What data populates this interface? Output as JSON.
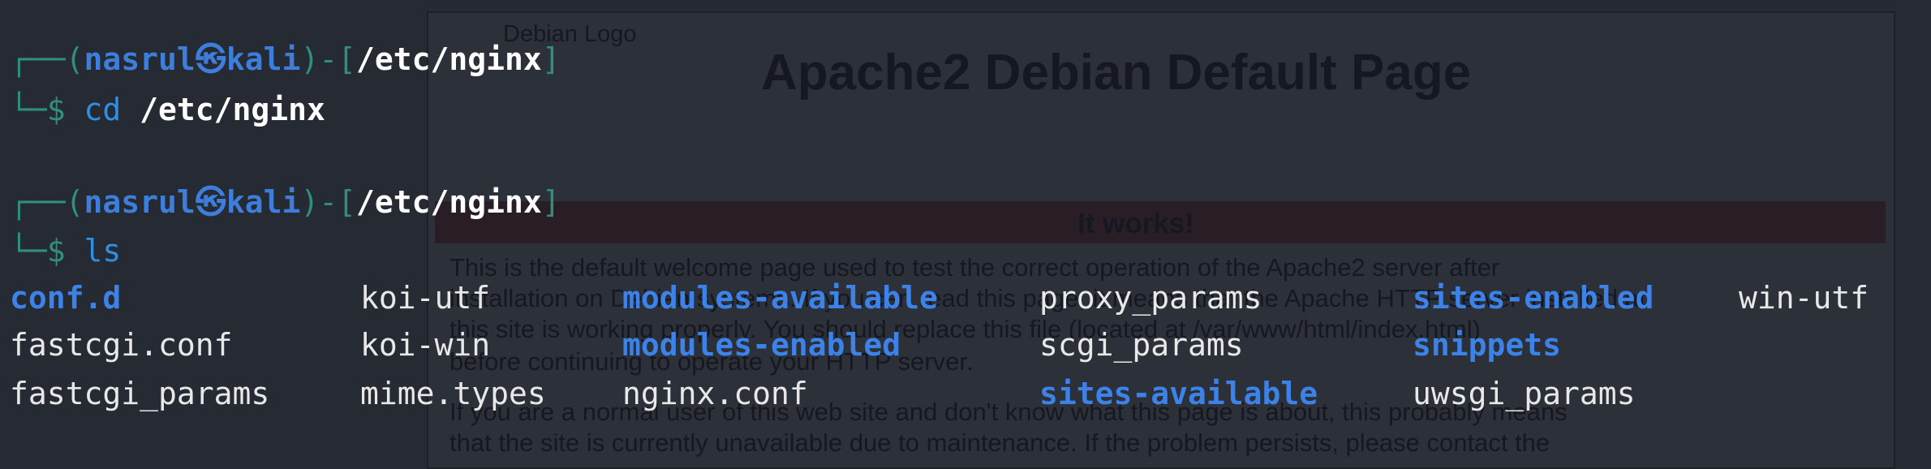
{
  "background_page": {
    "logo_alt": "Debian Logo",
    "title": "Apache2 Debian Default Page",
    "banner": "It works!",
    "paragraph_lines": [
      "This is the default welcome page used to test the correct operation of the Apache2 server after",
      "installation on Debian systems. If you can read this page, it means that the Apache HTTP server installed at",
      "this site is working properly. You should replace this file (located at /var/www/html/index.html)",
      "before continuing to operate your HTTP server.",
      "If you are a normal user of this web site and don't know what this page is about, this probably means",
      "that the site is currently unavailable due to maintenance. If the problem persists, please contact the"
    ]
  },
  "terminal": {
    "prompts": [
      {
        "frame_open": "┌──(",
        "user": "nasrul",
        "symbol": "㉿",
        "host": "kali",
        "frame_mid": ")-[",
        "path": "/etc/nginx",
        "frame_close": "]",
        "arrow": "└─$ ",
        "command": "cd",
        "argument": " /etc/nginx"
      },
      {
        "frame_open": "┌──(",
        "user": "nasrul",
        "symbol": "㉿",
        "host": "kali",
        "frame_mid": ")-[",
        "path": "/etc/nginx",
        "frame_close": "]",
        "arrow": "└─$ ",
        "command": "ls",
        "argument": ""
      }
    ],
    "ls_output": {
      "rows": [
        [
          {
            "name": "conf.d",
            "dir": true
          },
          {
            "name": "koi-utf",
            "dir": false
          },
          {
            "name": "modules-available",
            "dir": true
          },
          {
            "name": "proxy_params",
            "dir": false
          },
          {
            "name": "sites-enabled",
            "dir": true
          },
          {
            "name": "win-utf",
            "dir": false
          }
        ],
        [
          {
            "name": "fastcgi.conf",
            "dir": false
          },
          {
            "name": "koi-win",
            "dir": false
          },
          {
            "name": "modules-enabled",
            "dir": true
          },
          {
            "name": "scgi_params",
            "dir": false
          },
          {
            "name": "snippets",
            "dir": true
          },
          {
            "name": "",
            "dir": false
          }
        ],
        [
          {
            "name": "fastcgi_params",
            "dir": false
          },
          {
            "name": "mime.types",
            "dir": false
          },
          {
            "name": "nginx.conf",
            "dir": false
          },
          {
            "name": "sites-available",
            "dir": true
          },
          {
            "name": "uwsgi_params",
            "dir": false
          },
          {
            "name": "",
            "dir": false
          }
        ]
      ]
    }
  },
  "colors": {
    "background": "#262a33",
    "prompt_frame": "#2f8f7f",
    "user_host": "#3d7ddb",
    "directory": "#3c82e8",
    "text": "#e8e8e8"
  }
}
